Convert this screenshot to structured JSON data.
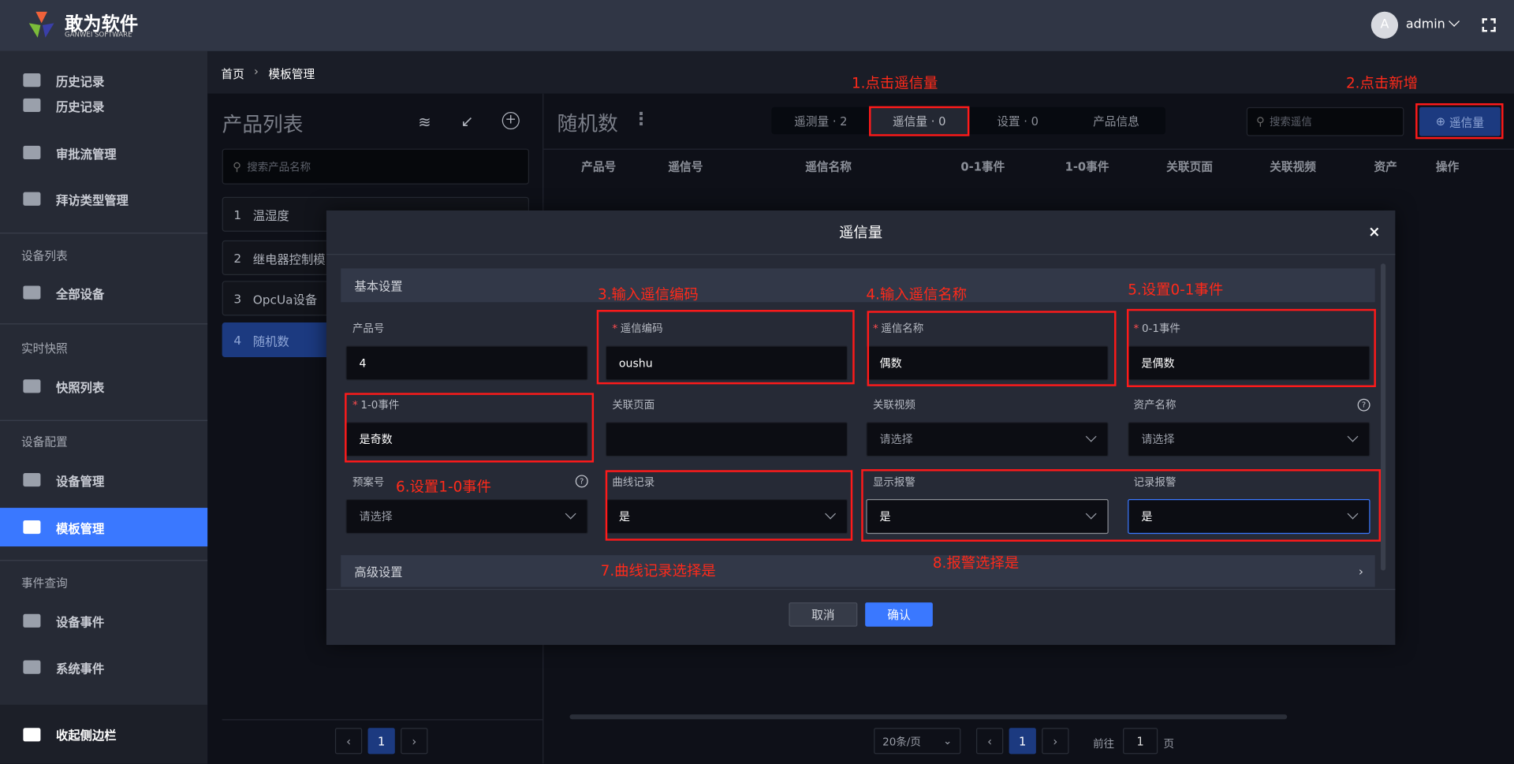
{
  "header": {
    "brand": "敢为软件",
    "brand_sub": "GANWEI SOFTWARE",
    "user_initial": "A",
    "user": "admin"
  },
  "sidebar": {
    "top_items": [
      "历史记录",
      "历史记录",
      "审批流管理",
      "拜访类型管理"
    ],
    "groups": [
      {
        "title": "设备列表",
        "items": [
          "全部设备"
        ]
      },
      {
        "title": "实时快照",
        "items": [
          "快照列表"
        ]
      },
      {
        "title": "设备配置",
        "items": [
          "设备管理",
          "模板管理"
        ]
      },
      {
        "title": "事件查询",
        "items": [
          "设备事件",
          "系统事件"
        ]
      }
    ],
    "active": "模板管理",
    "collapse": "收起侧边栏"
  },
  "breadcrumb": {
    "home": "首页",
    "current": "模板管理"
  },
  "product_panel": {
    "title": "产品列表",
    "search_placeholder": "搜索产品名称",
    "items": [
      {
        "no": "1",
        "name": "温湿度"
      },
      {
        "no": "2",
        "name": "继电器控制模"
      },
      {
        "no": "3",
        "name": "OpcUa设备"
      },
      {
        "no": "4",
        "name": "随机数"
      }
    ],
    "page": "1"
  },
  "detail": {
    "title": "随机数",
    "tabs": [
      "遥测量 · 2",
      "遥信量 · 0",
      "设置 · 0",
      "产品信息"
    ],
    "search_placeholder": "搜索遥信",
    "add_button": "遥信量",
    "columns": [
      "产品号",
      "遥信号",
      "遥信名称",
      "0-1事件",
      "1-0事件",
      "关联页面",
      "关联视频",
      "资产",
      "操作"
    ],
    "page_size": "20条/页",
    "page": "1",
    "goto_label": "前往",
    "goto_value": "1",
    "goto_suffix": "页"
  },
  "dialog": {
    "title": "遥信量",
    "basic": "基本设置",
    "advanced": "高级设置",
    "cancel": "取消",
    "confirm": "确认",
    "fields": {
      "product_no": {
        "label": "产品号",
        "value": "4"
      },
      "code": {
        "label": "遥信编码",
        "value": "oushu"
      },
      "name": {
        "label": "遥信名称",
        "value": "偶数"
      },
      "ev01": {
        "label": "0-1事件",
        "value": "是偶数"
      },
      "ev10": {
        "label": "1-0事件",
        "value": "是奇数"
      },
      "page": {
        "label": "关联页面",
        "value": ""
      },
      "video": {
        "label": "关联视频",
        "value": "请选择"
      },
      "asset": {
        "label": "资产名称",
        "value": "请选择"
      },
      "plan": {
        "label": "预案号",
        "value": "请选择"
      },
      "curve": {
        "label": "曲线记录",
        "value": "是"
      },
      "show_alarm": {
        "label": "显示报警",
        "value": "是"
      },
      "record_alarm": {
        "label": "记录报警",
        "value": "是"
      }
    }
  },
  "annotations": [
    "1.点击遥信量",
    "2.点击新增",
    "3.输入遥信编码",
    "4.输入遥信名称",
    "5.设置0-1事件",
    "6.设置1-0事件",
    "7.曲线记录选择是",
    "8.报警选择是"
  ],
  "colors": {
    "accent": "#3a78ff",
    "annotation": "#ff1a1a"
  }
}
